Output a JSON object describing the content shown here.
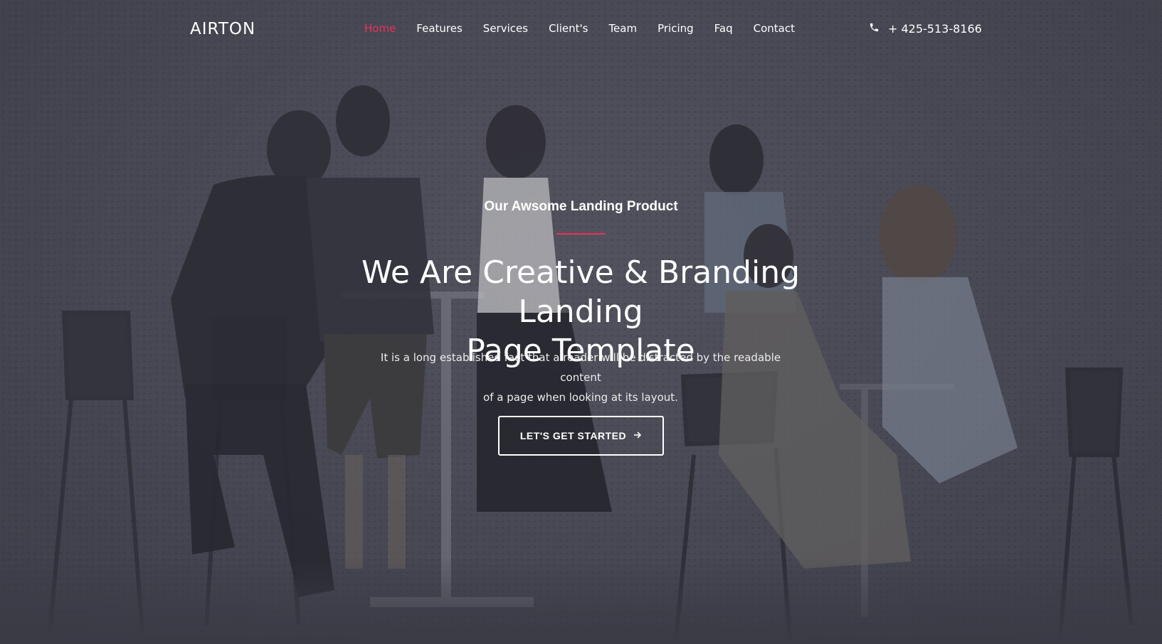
{
  "brand": {
    "logo_text": "AIRTON"
  },
  "nav": {
    "items": [
      {
        "label": "Home",
        "active": true
      },
      {
        "label": "Features",
        "active": false
      },
      {
        "label": "Services",
        "active": false
      },
      {
        "label": "Client's",
        "active": false
      },
      {
        "label": "Team",
        "active": false
      },
      {
        "label": "Pricing",
        "active": false
      },
      {
        "label": "Faq",
        "active": false
      },
      {
        "label": "Contact",
        "active": false
      }
    ],
    "phone": {
      "icon": "phone-icon",
      "number": "+ 425-513-8166"
    }
  },
  "hero": {
    "subtitle": "Our Awsome Landing Product",
    "headline_line1": "We Are Creative & Branding Landing",
    "headline_line2": "Page Template",
    "description_line1": "It is a long established fact that a reader will be distracted by the readable content",
    "description_line2": "of a page when looking at its layout.",
    "cta_label": "LET'S GET STARTED",
    "cta_icon": "arrow-right-icon"
  },
  "colors": {
    "accent": "#ee3157",
    "text": "#ffffff",
    "overlay": "#4a4b55"
  }
}
